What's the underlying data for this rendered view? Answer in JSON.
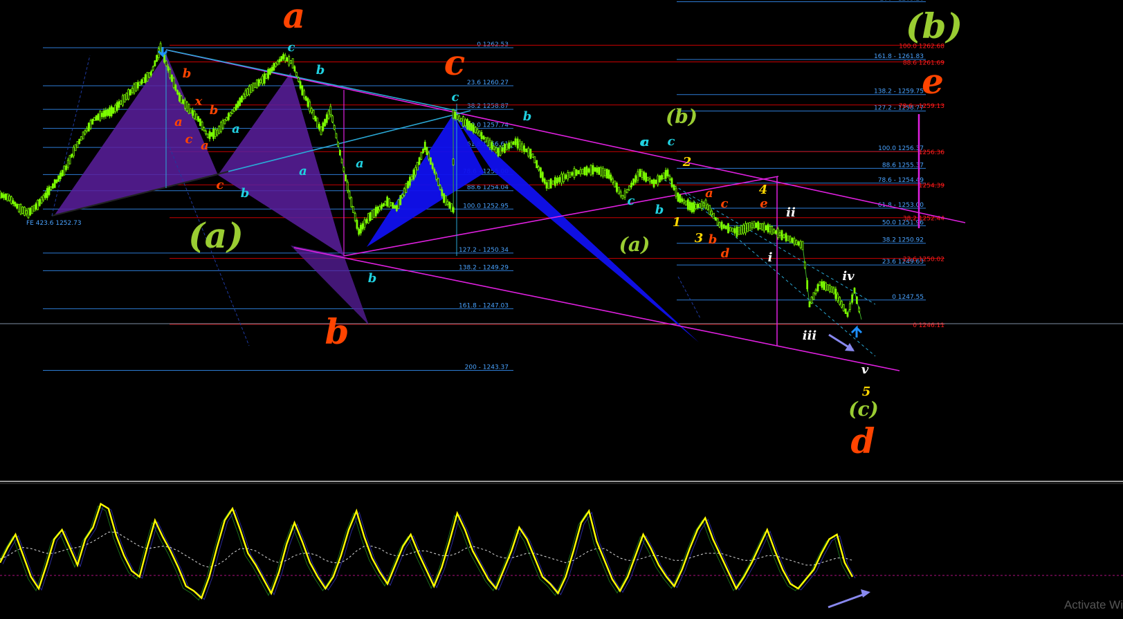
{
  "window": {
    "watermark": "Activate Wi"
  },
  "colors": {
    "background": "#000000",
    "candle_up": "#7cfc00",
    "fib_blue": "#2e7dd6",
    "fib_red": "#cc0000",
    "magenta": "#e020e0",
    "cyan": "#2aa9d6",
    "harmonic_purple": "#5a1f9e",
    "harmonic_blue": "#1010ee",
    "oscillator": "#ffff00",
    "label_orange": "#ff4400",
    "label_olive": "#9acd32",
    "label_cyan": "#20d0e0",
    "label_yellow": "#ffd700",
    "label_white": "#ffffff"
  },
  "chart_data": [
    {
      "type": "line",
      "panel": "price",
      "y_scale_labels": "price",
      "x": [
        0,
        10,
        20,
        30,
        40,
        50,
        60,
        70,
        80,
        90,
        100,
        110,
        120,
        130,
        140,
        150,
        160,
        170,
        180,
        190,
        200,
        210,
        220,
        230,
        240,
        250,
        260,
        270,
        280,
        290,
        300,
        310,
        320,
        330,
        340,
        350,
        360,
        370,
        380,
        390,
        400,
        410,
        420,
        430,
        440,
        450,
        460,
        470,
        480
      ],
      "values": [
        1253.8,
        1253.6,
        1253.0,
        1252.7,
        1253.2,
        1253.9,
        1254.6,
        1255.4,
        1256.6,
        1257.5,
        1258.3,
        1258.6,
        1258.8,
        1259.4,
        1260.0,
        1260.5,
        1261.0,
        1262.5,
        1261.0,
        1259.6,
        1258.9,
        1258.3,
        1257.3,
        1257.5,
        1258.3,
        1259.0,
        1259.8,
        1260.3,
        1260.7,
        1261.4,
        1262.0,
        1261.6,
        1260.0,
        1258.8,
        1257.6,
        1258.8,
        1256.3,
        1253.8,
        1251.6,
        1252.4,
        1252.9,
        1253.4,
        1253.0,
        1254.2,
        1255.2,
        1256.7,
        1255.2,
        1253.6,
        1252.9
      ]
    },
    {
      "type": "line",
      "panel": "oscillator",
      "series": [
        {
          "values": [
            42,
            55,
            66,
            48,
            30,
            20,
            40,
            62,
            70,
            55,
            40,
            62,
            72,
            92,
            88,
            65,
            48,
            35,
            30,
            55,
            78,
            64,
            52,
            38,
            22,
            18,
            12,
            30,
            55,
            78,
            88,
            70,
            50,
            40,
            28,
            16,
            34,
            58,
            76,
            60,
            42,
            30,
            20,
            30,
            48,
            70,
            86,
            64,
            46,
            34,
            24,
            40,
            56,
            66,
            50,
            36,
            22,
            38,
            60,
            84,
            70,
            52,
            40,
            28,
            20,
            36,
            52,
            72,
            62,
            46,
            30,
            24,
            16,
            30,
            52,
            76,
            86,
            60,
            44,
            28,
            18,
            30,
            48,
            66,
            54,
            40,
            30,
            22,
            36,
            54,
            70,
            80,
            62,
            48,
            34,
            20,
            30,
            42,
            56,
            70,
            52,
            36,
            24,
            20,
            28,
            36,
            50,
            62,
            66,
            42,
            30
          ]
        },
        {
          "values": [
            45,
            48,
            52,
            55,
            54,
            52,
            50,
            50,
            52,
            54,
            55,
            57,
            60,
            64,
            68,
            68,
            64,
            60,
            56,
            54,
            55,
            56,
            55,
            52,
            48,
            44,
            40,
            38,
            40,
            44,
            50,
            54,
            54,
            52,
            48,
            44,
            42,
            44,
            48,
            50,
            50,
            48,
            44,
            42,
            42,
            46,
            52,
            56,
            56,
            54,
            50,
            48,
            48,
            50,
            52,
            52,
            50,
            48,
            48,
            50,
            54,
            56,
            54,
            52,
            48,
            46,
            46,
            48,
            50,
            50,
            48,
            46,
            44,
            42,
            44,
            48,
            52,
            54,
            54,
            50,
            46,
            44,
            44,
            46,
            48,
            48,
            46,
            44,
            44,
            46,
            48,
            50,
            50,
            50,
            48,
            46,
            44,
            44,
            46,
            48,
            48,
            46,
            44,
            42,
            40,
            40,
            42,
            44,
            46,
            46,
            44
          ]
        }
      ]
    }
  ],
  "fib_levels_left": [
    {
      "label": "0 1262.53",
      "price": 1262.53
    },
    {
      "label": "23.6 1260.27",
      "price": 1260.27
    },
    {
      "label": "38.2 1258.87",
      "price": 1258.87
    },
    {
      "label": "50.0 1257.74",
      "price": 1257.74
    },
    {
      "label": "61.8 1256.61",
      "price": 1256.61
    },
    {
      "label": "78.6 - 1255.00",
      "price": 1255.0
    },
    {
      "label": "88.6 1254.04",
      "price": 1254.04
    },
    {
      "label": "100.0 1252.95",
      "price": 1252.95
    },
    {
      "label": "127.2 - 1250.34",
      "price": 1250.34
    },
    {
      "label": "138.2 - 1249.29",
      "price": 1249.29
    },
    {
      "label": "161.8 - 1247.03",
      "price": 1247.03
    },
    {
      "label": "200 - 1243.37",
      "price": 1243.37
    }
  ],
  "fib_levels_right": [
    {
      "label": "200 - 1265.26",
      "price": 1265.26
    },
    {
      "label": "161.8 - 1261.83",
      "price": 1261.83
    },
    {
      "label": "138.2 - 1259.75",
      "price": 1259.75
    },
    {
      "label": "127.2 - 1258.77",
      "price": 1258.77
    },
    {
      "label": "100.0 1256.37",
      "price": 1256.37
    },
    {
      "label": "88.6 1255.37",
      "price": 1255.37
    },
    {
      "label": "78.6 - 1254.49",
      "price": 1254.49
    },
    {
      "label": "61.8 - 1253.00",
      "price": 1253.0
    },
    {
      "label": "50.0 1251.96",
      "price": 1251.96
    },
    {
      "label": "38.2 1250.92",
      "price": 1250.92
    },
    {
      "label": "23.6 1249.63",
      "price": 1249.63
    },
    {
      "label": "0 1247.55",
      "price": 1247.55
    }
  ],
  "fib_levels_red": [
    {
      "label": "100.0 1262.68",
      "price": 1262.68
    },
    {
      "label": "88.6 1261.69",
      "price": 1261.69
    },
    {
      "label": "78.6 - 1259.13",
      "price": 1259.13
    },
    {
      "label": "1256.36",
      "price": 1256.36
    },
    {
      "label": "1254.39",
      "price": 1254.39
    },
    {
      "label": "38.2 1252.44",
      "price": 1252.44
    },
    {
      "label": "23.6 1250.02",
      "price": 1250.02
    },
    {
      "label": "0 1246.11",
      "price": 1246.11
    }
  ],
  "fe_label": "FE 423.6 1252.73",
  "wave_labels": [
    {
      "text": "a",
      "color": "orange",
      "size": "xl"
    },
    {
      "text": "c",
      "color": "orange",
      "size": "xl"
    },
    {
      "text": "b",
      "color": "orange",
      "size": "xl"
    },
    {
      "text": "d",
      "color": "orange",
      "size": "xl"
    },
    {
      "text": "e",
      "color": "orange",
      "size": "xl"
    },
    {
      "text": "(a)",
      "color": "olive",
      "size": "xl"
    },
    {
      "text": "(b)",
      "color": "olive",
      "size": "xl"
    },
    {
      "text": "(b)",
      "color": "olive",
      "size": "md"
    },
    {
      "text": "(a)",
      "color": "olive",
      "size": "md"
    },
    {
      "text": "(c)",
      "color": "olive",
      "size": "md"
    },
    {
      "text": "c",
      "color": "cyan",
      "size": "sm"
    },
    {
      "text": "b",
      "color": "cyan",
      "size": "sm"
    },
    {
      "text": "a",
      "color": "cyan",
      "size": "sm"
    },
    {
      "text": "a",
      "color": "cyan",
      "size": "sm"
    },
    {
      "text": "b",
      "color": "cyan",
      "size": "sm"
    },
    {
      "text": "a",
      "color": "cyan",
      "size": "sm"
    },
    {
      "text": "c",
      "color": "cyan",
      "size": "sm"
    },
    {
      "text": "b",
      "color": "cyan",
      "size": "sm"
    },
    {
      "text": "c",
      "color": "cyan",
      "size": "sm"
    },
    {
      "text": "b",
      "color": "cyan",
      "size": "sm"
    },
    {
      "text": "a",
      "color": "cyan",
      "size": "sm"
    },
    {
      "text": "c",
      "color": "cyan",
      "size": "sm"
    },
    {
      "text": "c",
      "color": "cyan",
      "size": "sm"
    },
    {
      "text": "b",
      "color": "cyan",
      "size": "sm"
    },
    {
      "text": "b",
      "color": "orange",
      "size": "sm"
    },
    {
      "text": "a",
      "color": "orange",
      "size": "sm"
    },
    {
      "text": "x",
      "color": "orange",
      "size": "sm"
    },
    {
      "text": "b",
      "color": "orange",
      "size": "sm"
    },
    {
      "text": "c",
      "color": "orange",
      "size": "sm"
    },
    {
      "text": "a",
      "color": "orange",
      "size": "sm"
    },
    {
      "text": "c",
      "color": "orange",
      "size": "sm"
    },
    {
      "text": "a",
      "color": "orange",
      "size": "sm"
    },
    {
      "text": "c",
      "color": "orange",
      "size": "sm"
    },
    {
      "text": "b",
      "color": "orange",
      "size": "sm"
    },
    {
      "text": "d",
      "color": "orange",
      "size": "sm"
    },
    {
      "text": "e",
      "color": "orange",
      "size": "sm"
    },
    {
      "text": "2",
      "color": "yellow",
      "size": "sm"
    },
    {
      "text": "1",
      "color": "yellow",
      "size": "sm"
    },
    {
      "text": "3",
      "color": "yellow",
      "size": "sm"
    },
    {
      "text": "4",
      "color": "yellow",
      "size": "sm"
    },
    {
      "text": "5",
      "color": "yellow",
      "size": "sm"
    },
    {
      "text": "i",
      "color": "white",
      "size": "sm"
    },
    {
      "text": "ii",
      "color": "white",
      "size": "sm"
    },
    {
      "text": "iii",
      "color": "white",
      "size": "sm"
    },
    {
      "text": "iv",
      "color": "white",
      "size": "sm"
    },
    {
      "text": "v",
      "color": "white",
      "size": "sm"
    }
  ]
}
